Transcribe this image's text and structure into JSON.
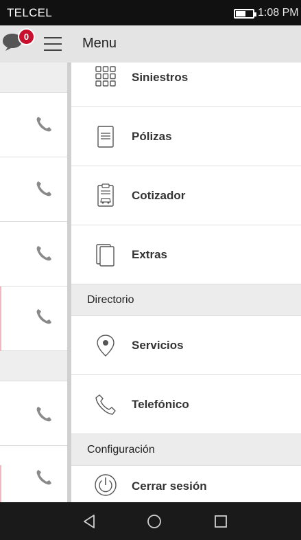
{
  "status_bar": {
    "carrier": "TELCEL",
    "time": "1:08 PM",
    "battery_level": 0.6
  },
  "left_panel": {
    "notification_count": "0"
  },
  "drawer": {
    "title": "Menu",
    "items": [
      {
        "label": "Siniestros",
        "icon": "grid-icon"
      },
      {
        "label": "Pólizas",
        "icon": "document-icon"
      },
      {
        "label": "Cotizador",
        "icon": "car-quote-icon"
      },
      {
        "label": "Extras",
        "icon": "pages-icon"
      }
    ],
    "sections": [
      {
        "label": "Directorio",
        "items": [
          {
            "label": "Servicios",
            "icon": "location-pin-icon"
          },
          {
            "label": "Telefónico",
            "icon": "phone-icon"
          }
        ]
      },
      {
        "label": "Configuración",
        "items": [
          {
            "label": "Cerrar sesión",
            "icon": "power-icon"
          }
        ]
      }
    ]
  },
  "colors": {
    "accent": "#c8102e",
    "header_bg": "#e4e4e4",
    "section_bg": "#ececec",
    "nav_bg": "#1a1a1a"
  }
}
